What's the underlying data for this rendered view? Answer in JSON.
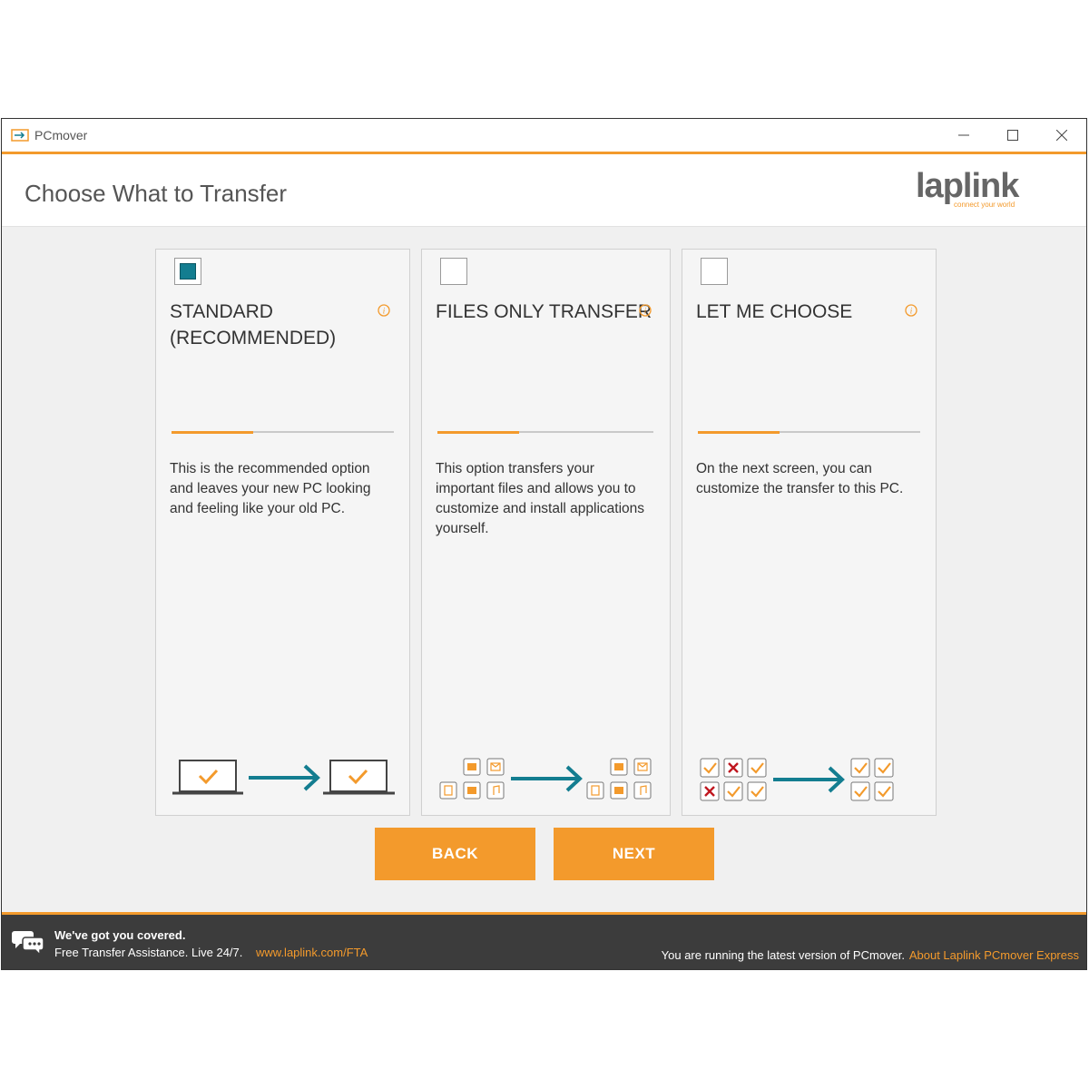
{
  "window": {
    "title": "PCmover",
    "controls": [
      "minimize",
      "maximize",
      "close"
    ]
  },
  "header": {
    "title": "Choose What to Transfer",
    "logo_text": "laplink",
    "logo_tagline": "connect your world"
  },
  "options": [
    {
      "title": "STANDARD (RECOMMENDED)",
      "checked": true,
      "description": "This is the recommended option and leaves your new PC looking and feeling like your old PC.",
      "illustration": "laptop-to-laptop"
    },
    {
      "title": "FILES ONLY TRANSFER",
      "checked": false,
      "description": "This option transfers your important files and allows you to customize and install applications yourself.",
      "illustration": "files-to-files"
    },
    {
      "title": "LET ME CHOOSE",
      "checked": false,
      "description": "On the next screen, you can customize the transfer to this PC.",
      "illustration": "checklist-to-checklist"
    }
  ],
  "buttons": {
    "back": "BACK",
    "next": "NEXT"
  },
  "footer": {
    "headline": "We've got you covered.",
    "assist": "Free Transfer Assistance. Live 24/7.",
    "link": "www.laplink.com/FTA",
    "status": "You are running the latest version of PCmover.",
    "about": "About Laplink PCmover Express"
  },
  "colors": {
    "accent": "#f39a2c",
    "teal": "#137d90",
    "footer_bg": "#3c3c3c"
  }
}
